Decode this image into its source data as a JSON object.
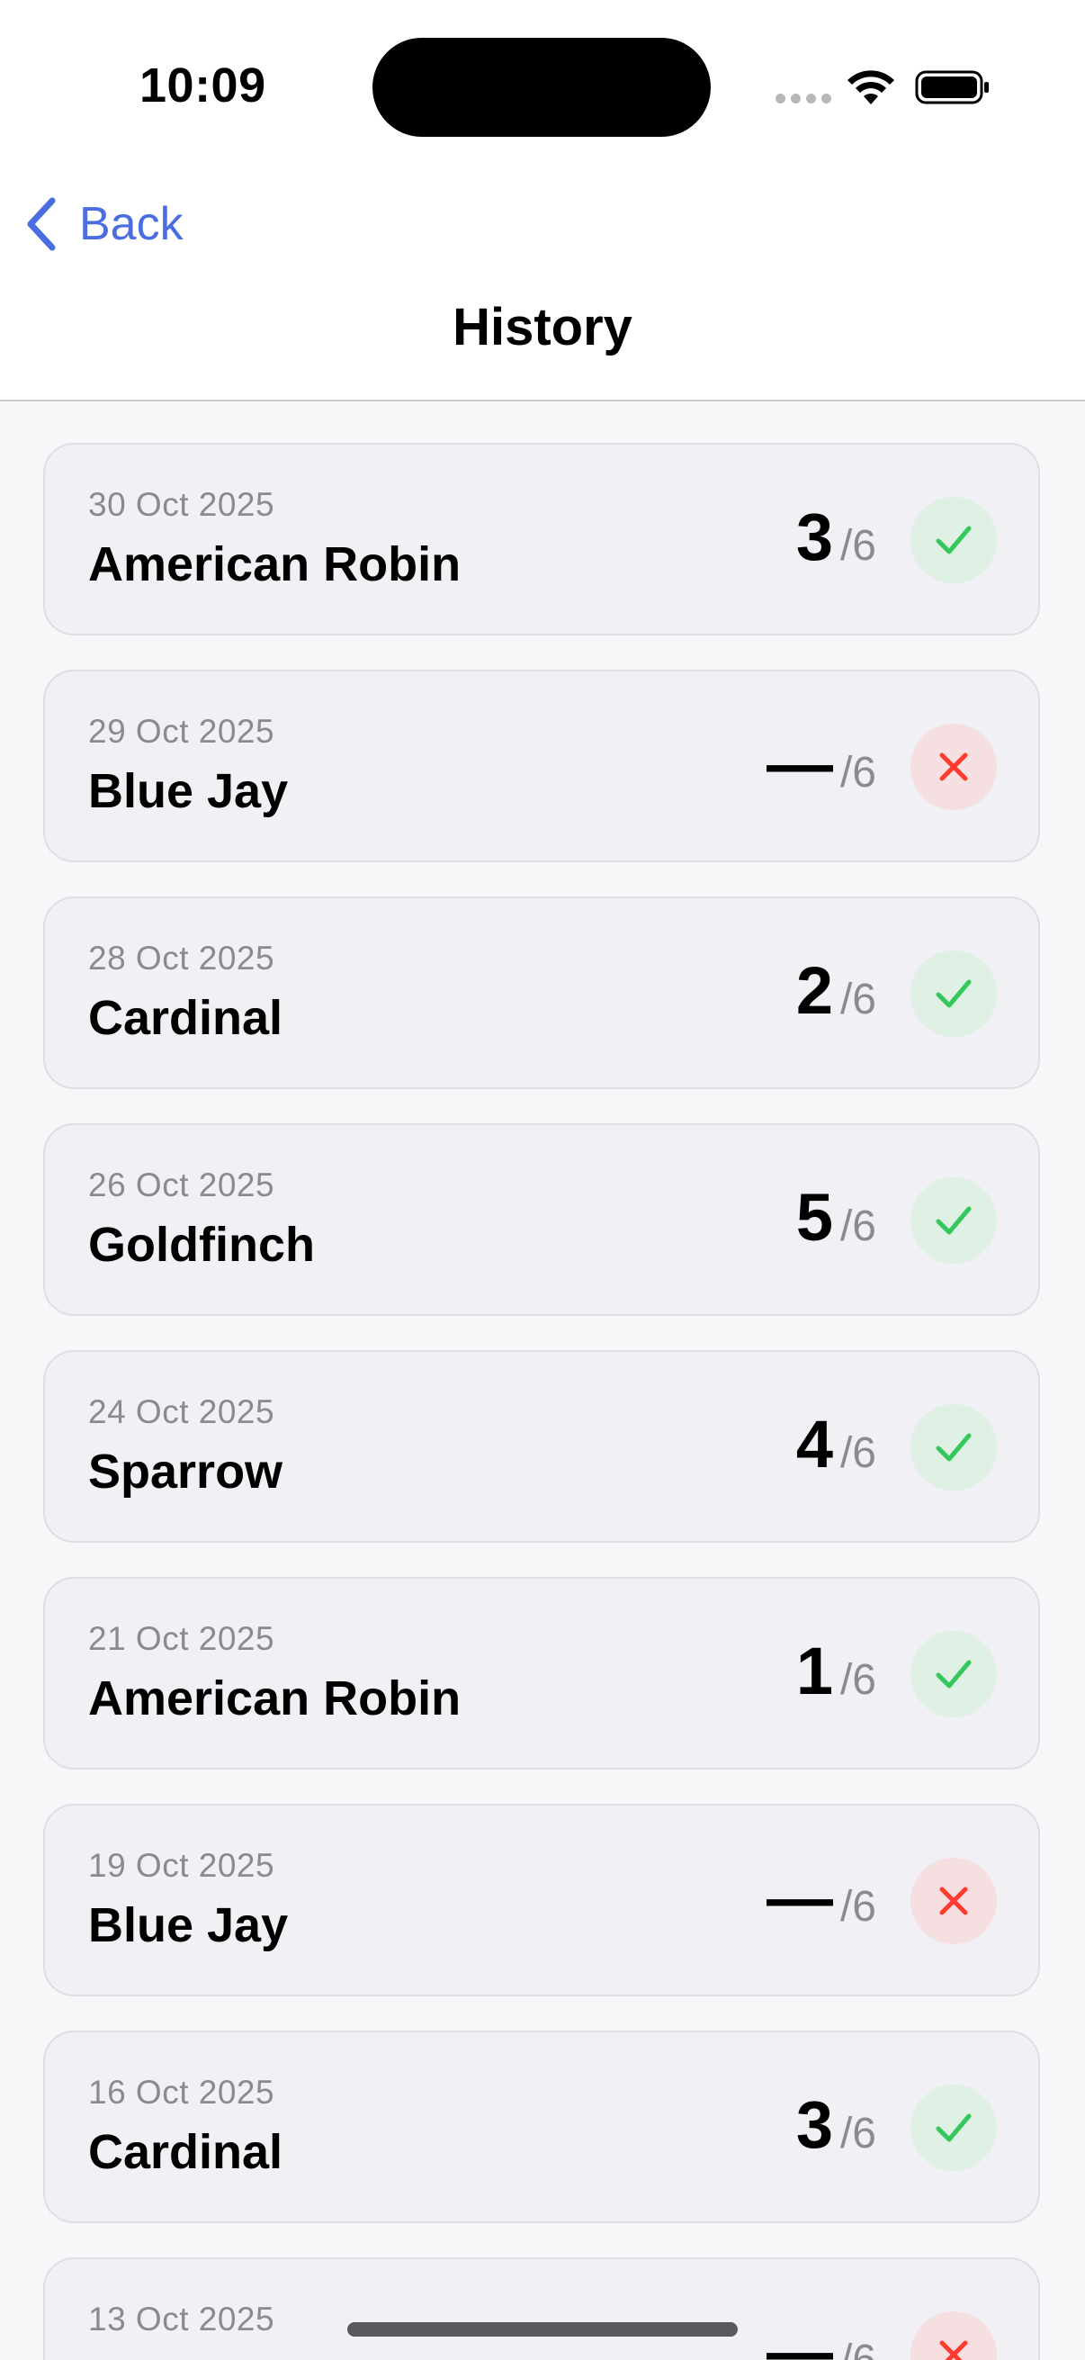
{
  "status_bar": {
    "time": "10:09"
  },
  "nav": {
    "back_label": "Back",
    "title": "History"
  },
  "colors": {
    "accent": "#4a6ee0",
    "success": "#34c759",
    "success_bg": "#dff0e4",
    "fail": "#ff3b30",
    "fail_bg": "#f6dfe0"
  },
  "history": [
    {
      "date": "30 Oct 2025",
      "bird": "American Robin",
      "score": "3",
      "total": "/6",
      "result": "success",
      "icon": "checkmark-icon"
    },
    {
      "date": "29 Oct 2025",
      "bird": "Blue Jay",
      "score": "—",
      "total": "/6",
      "result": "fail",
      "icon": "x-mark-icon"
    },
    {
      "date": "28 Oct 2025",
      "bird": "Cardinal",
      "score": "2",
      "total": "/6",
      "result": "success",
      "icon": "checkmark-icon"
    },
    {
      "date": "26 Oct 2025",
      "bird": "Goldfinch",
      "score": "5",
      "total": "/6",
      "result": "success",
      "icon": "checkmark-icon"
    },
    {
      "date": "24 Oct 2025",
      "bird": "Sparrow",
      "score": "4",
      "total": "/6",
      "result": "success",
      "icon": "checkmark-icon"
    },
    {
      "date": "21 Oct 2025",
      "bird": "American Robin",
      "score": "1",
      "total": "/6",
      "result": "success",
      "icon": "checkmark-icon"
    },
    {
      "date": "19 Oct 2025",
      "bird": "Blue Jay",
      "score": "—",
      "total": "/6",
      "result": "fail",
      "icon": "x-mark-icon"
    },
    {
      "date": "16 Oct 2025",
      "bird": "Cardinal",
      "score": "3",
      "total": "/6",
      "result": "success",
      "icon": "checkmark-icon"
    },
    {
      "date": "13 Oct 2025",
      "bird": "",
      "score": "—",
      "total": "/6",
      "result": "fail",
      "icon": "x-mark-icon"
    }
  ]
}
